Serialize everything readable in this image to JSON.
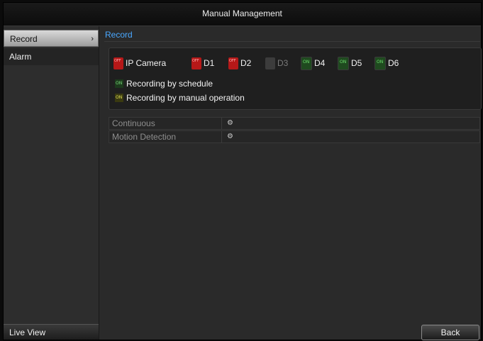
{
  "window": {
    "title": "Manual Management"
  },
  "sidebar": {
    "items": [
      {
        "label": "Record",
        "selected": true,
        "chevron": "›"
      },
      {
        "label": "Alarm"
      }
    ],
    "footer_label": "Live View"
  },
  "main": {
    "tab": "Record",
    "channels": [
      {
        "label": "IP Camera",
        "state": "off"
      },
      {
        "label": "D1",
        "state": "off"
      },
      {
        "label": "D2",
        "state": "off"
      },
      {
        "label": "D3",
        "state": "unavailable"
      },
      {
        "label": "D4",
        "state": "on"
      },
      {
        "label": "D5",
        "state": "on"
      },
      {
        "label": "D6",
        "state": "on"
      }
    ],
    "legend": [
      {
        "label": "Recording by schedule"
      },
      {
        "label": "Recording by manual operation"
      }
    ],
    "rows": [
      {
        "label": "Continuous"
      },
      {
        "label": "Motion Detection"
      }
    ],
    "back_label": "Back"
  },
  "colors": {
    "off": "#b61818",
    "on_schedule": "#7bd97b",
    "on_manual": "#e3e35a",
    "tab_accent": "#4aa8ff"
  },
  "icons": {
    "settings": "gear-icon"
  }
}
